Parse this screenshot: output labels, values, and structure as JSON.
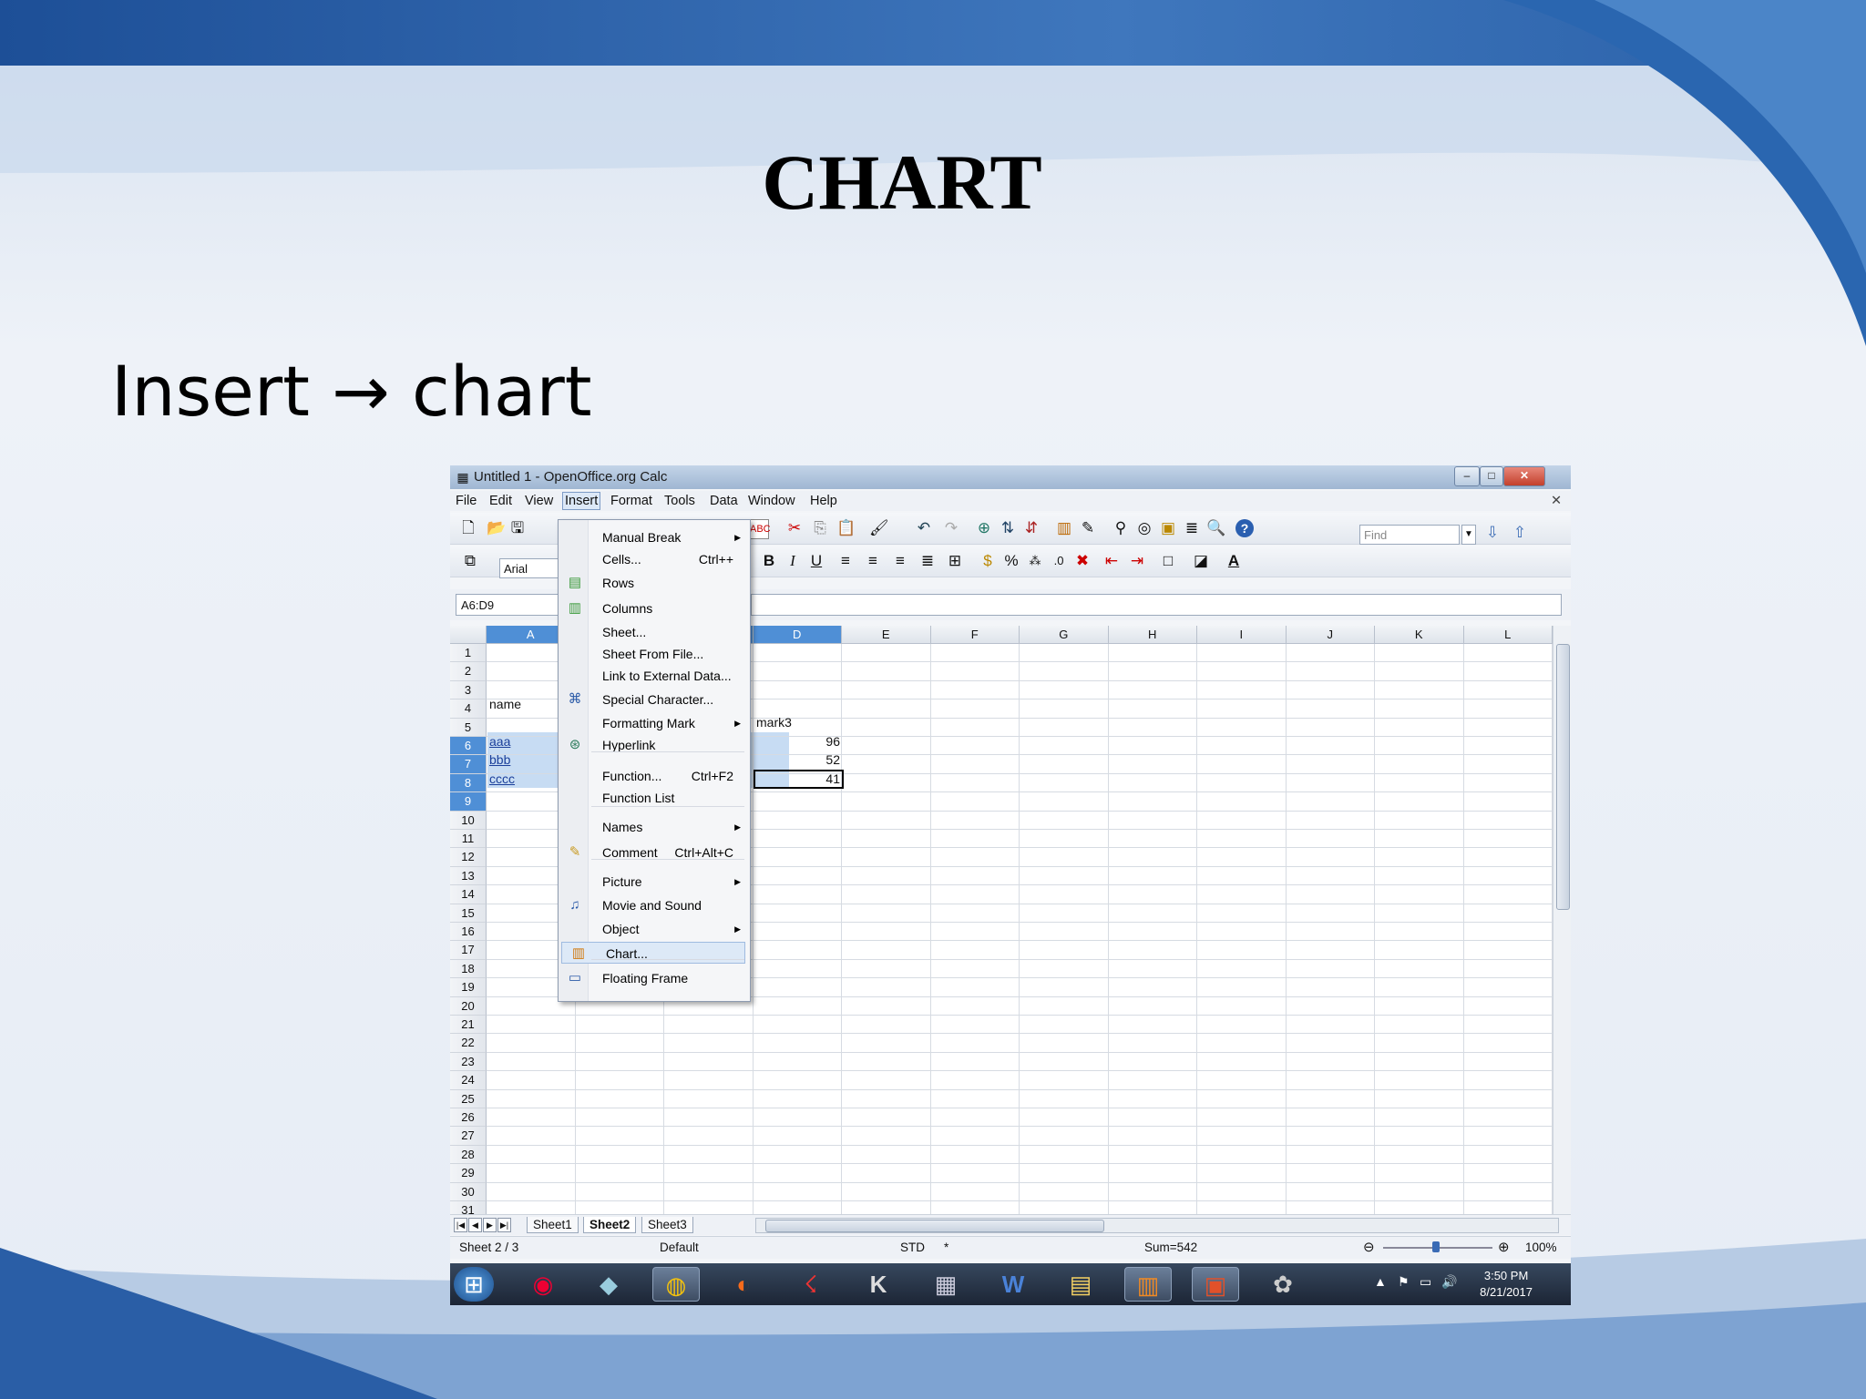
{
  "slide": {
    "title": "CHART",
    "subtitle": "Insert → chart"
  },
  "window": {
    "title": "Untitled 1 - OpenOffice.org Calc",
    "close_doc": "✕"
  },
  "menubar": [
    {
      "label": "File"
    },
    {
      "label": "Edit"
    },
    {
      "label": "View"
    },
    {
      "label": "Insert"
    },
    {
      "label": "Format"
    },
    {
      "label": "Tools"
    },
    {
      "label": "Data"
    },
    {
      "label": "Window"
    },
    {
      "label": "Help"
    }
  ],
  "toolbar": {
    "find_placeholder": "Find",
    "font_name": "Arial"
  },
  "formula_bar": {
    "name_box": "A6:D9"
  },
  "insert_menu": [
    {
      "label": "Manual Break",
      "shortcut": "",
      "submenu": true,
      "icon": ""
    },
    {
      "label": "Cells...",
      "shortcut": "Ctrl++",
      "submenu": false,
      "icon": ""
    },
    {
      "label": "Rows",
      "shortcut": "",
      "submenu": false,
      "icon": "rows-icon"
    },
    {
      "label": "Columns",
      "shortcut": "",
      "submenu": false,
      "icon": "columns-icon"
    },
    {
      "label": "Sheet...",
      "shortcut": "",
      "submenu": false,
      "icon": ""
    },
    {
      "label": "Sheet From File...",
      "shortcut": "",
      "submenu": false,
      "icon": ""
    },
    {
      "label": "Link to External Data...",
      "shortcut": "",
      "submenu": false,
      "icon": ""
    },
    {
      "label": "Special Character...",
      "shortcut": "",
      "submenu": false,
      "icon": "special-character-icon"
    },
    {
      "label": "Formatting Mark",
      "shortcut": "",
      "submenu": true,
      "icon": ""
    },
    {
      "label": "Hyperlink",
      "shortcut": "",
      "submenu": false,
      "icon": "hyperlink-icon"
    },
    {
      "label": "Function...",
      "shortcut": "Ctrl+F2",
      "submenu": false,
      "icon": ""
    },
    {
      "label": "Function List",
      "shortcut": "",
      "submenu": false,
      "icon": ""
    },
    {
      "label": "Names",
      "shortcut": "",
      "submenu": true,
      "icon": ""
    },
    {
      "label": "Comment",
      "shortcut": "Ctrl+Alt+C",
      "submenu": false,
      "icon": "comment-icon"
    },
    {
      "label": "Picture",
      "shortcut": "",
      "submenu": true,
      "icon": ""
    },
    {
      "label": "Movie and Sound",
      "shortcut": "",
      "submenu": false,
      "icon": "movie-icon"
    },
    {
      "label": "Object",
      "shortcut": "",
      "submenu": true,
      "icon": ""
    },
    {
      "label": "Chart...",
      "shortcut": "",
      "submenu": false,
      "icon": "chart-icon",
      "highlighted": true
    },
    {
      "label": "Floating Frame",
      "shortcut": "",
      "submenu": false,
      "icon": "floating-frame-icon"
    }
  ],
  "grid": {
    "columns": [
      "A",
      "B",
      "C",
      "D",
      "E",
      "F",
      "G",
      "H",
      "I",
      "J",
      "K",
      "L"
    ],
    "visible_rows": 31,
    "cells": [
      {
        "ref": "A5",
        "text": "name"
      },
      {
        "ref": "D6",
        "text": "mark3"
      },
      {
        "ref": "A7",
        "text": "aaa"
      },
      {
        "ref": "A8",
        "text": "bbb"
      },
      {
        "ref": "A9",
        "text": "cccc"
      },
      {
        "ref": "D7",
        "text": "96"
      },
      {
        "ref": "D8",
        "text": "52"
      },
      {
        "ref": "D9",
        "text": "41"
      }
    ]
  },
  "sheet_tabs": [
    {
      "label": "Sheet1",
      "active": false
    },
    {
      "label": "Sheet2",
      "active": true
    },
    {
      "label": "Sheet3",
      "active": false
    }
  ],
  "statusbar": {
    "sheet": "Sheet 2 / 3",
    "style": "Default",
    "mode": "STD",
    "modified": "*",
    "sum": "Sum=542",
    "zoom": "100%"
  },
  "taskbar": {
    "time": "3:50 PM",
    "date": "8/21/2017"
  },
  "colors": {
    "selection": "#c7dcf3",
    "header_selected": "#4f8fd6",
    "menu_highlight": "#dde9f7"
  }
}
